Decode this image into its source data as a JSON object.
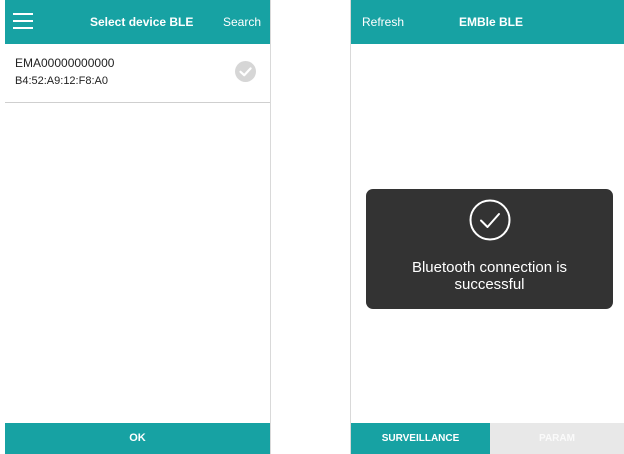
{
  "left": {
    "appbar": {
      "title": "Select device BLE",
      "search": "Search",
      "menu_icon": "hamburger-menu-icon"
    },
    "devices": [
      {
        "name": "EMA00000000000",
        "mac": "B4:52:A9:12:F8:A0",
        "icon": "check-circle-icon"
      }
    ],
    "ok_label": "OK"
  },
  "right": {
    "appbar": {
      "refresh": "Refresh",
      "title": "EMBle BLE"
    },
    "toast": {
      "icon": "check-circle-icon",
      "line1": "Bluetooth connection is",
      "line2": "successful"
    },
    "tabs": [
      {
        "label": "SURVEILLANCE",
        "active": true
      },
      {
        "label": "PARAM",
        "active": false
      }
    ]
  },
  "colors": {
    "accent": "#17a2a3",
    "toast_bg": "#333333",
    "tab_inactive_bg": "#e8e8e8"
  }
}
